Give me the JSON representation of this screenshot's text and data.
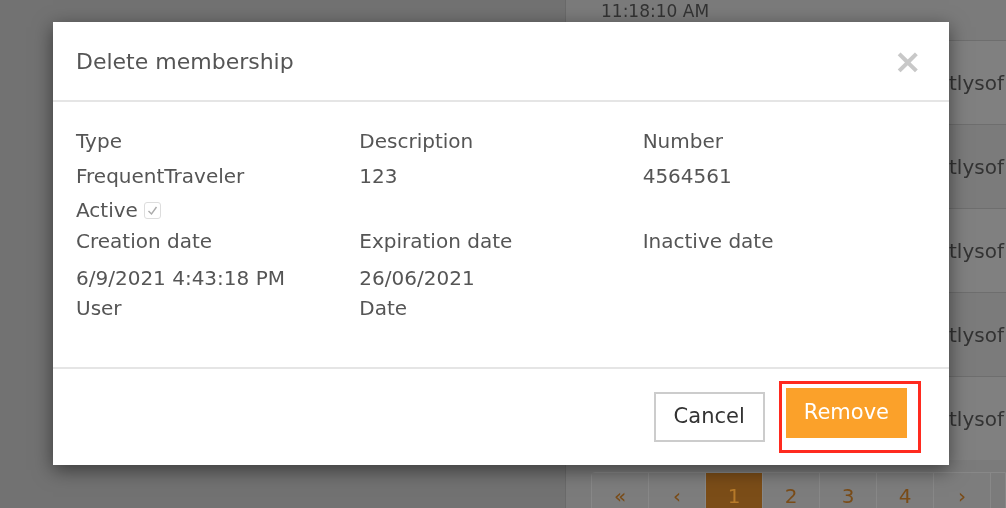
{
  "background": {
    "time": "11:18:10 AM",
    "rows": [
      "tlysof",
      "tlysof",
      "tlysof",
      "tlysof",
      "tlysof"
    ],
    "pagination": [
      {
        "label": "«",
        "selected": false
      },
      {
        "label": "‹",
        "selected": false
      },
      {
        "label": "1",
        "selected": true
      },
      {
        "label": "2",
        "selected": false
      },
      {
        "label": "3",
        "selected": false
      },
      {
        "label": "4",
        "selected": false
      },
      {
        "label": "›",
        "selected": false
      }
    ]
  },
  "dialog": {
    "title": "Delete membership",
    "close": "×",
    "fields": [
      {
        "label": "Type",
        "value": "FrequentTraveler"
      },
      {
        "label": "Description",
        "value": "123"
      },
      {
        "label": "Number",
        "value": "4564561"
      }
    ],
    "active": {
      "label": "Active",
      "checked": true
    },
    "dates": [
      {
        "label": "Creation date",
        "value": "6/9/2021 4:43:18 PM",
        "sublabel": "User"
      },
      {
        "label": "Expiration date",
        "value": "26/06/2021",
        "sublabel": "Date"
      },
      {
        "label": "Inactive date"
      }
    ],
    "buttons": [
      {
        "label": "Cancel",
        "kind": "secondary",
        "highlighted": false
      },
      {
        "label": "Remove",
        "kind": "primary",
        "highlighted": true
      }
    ]
  }
}
